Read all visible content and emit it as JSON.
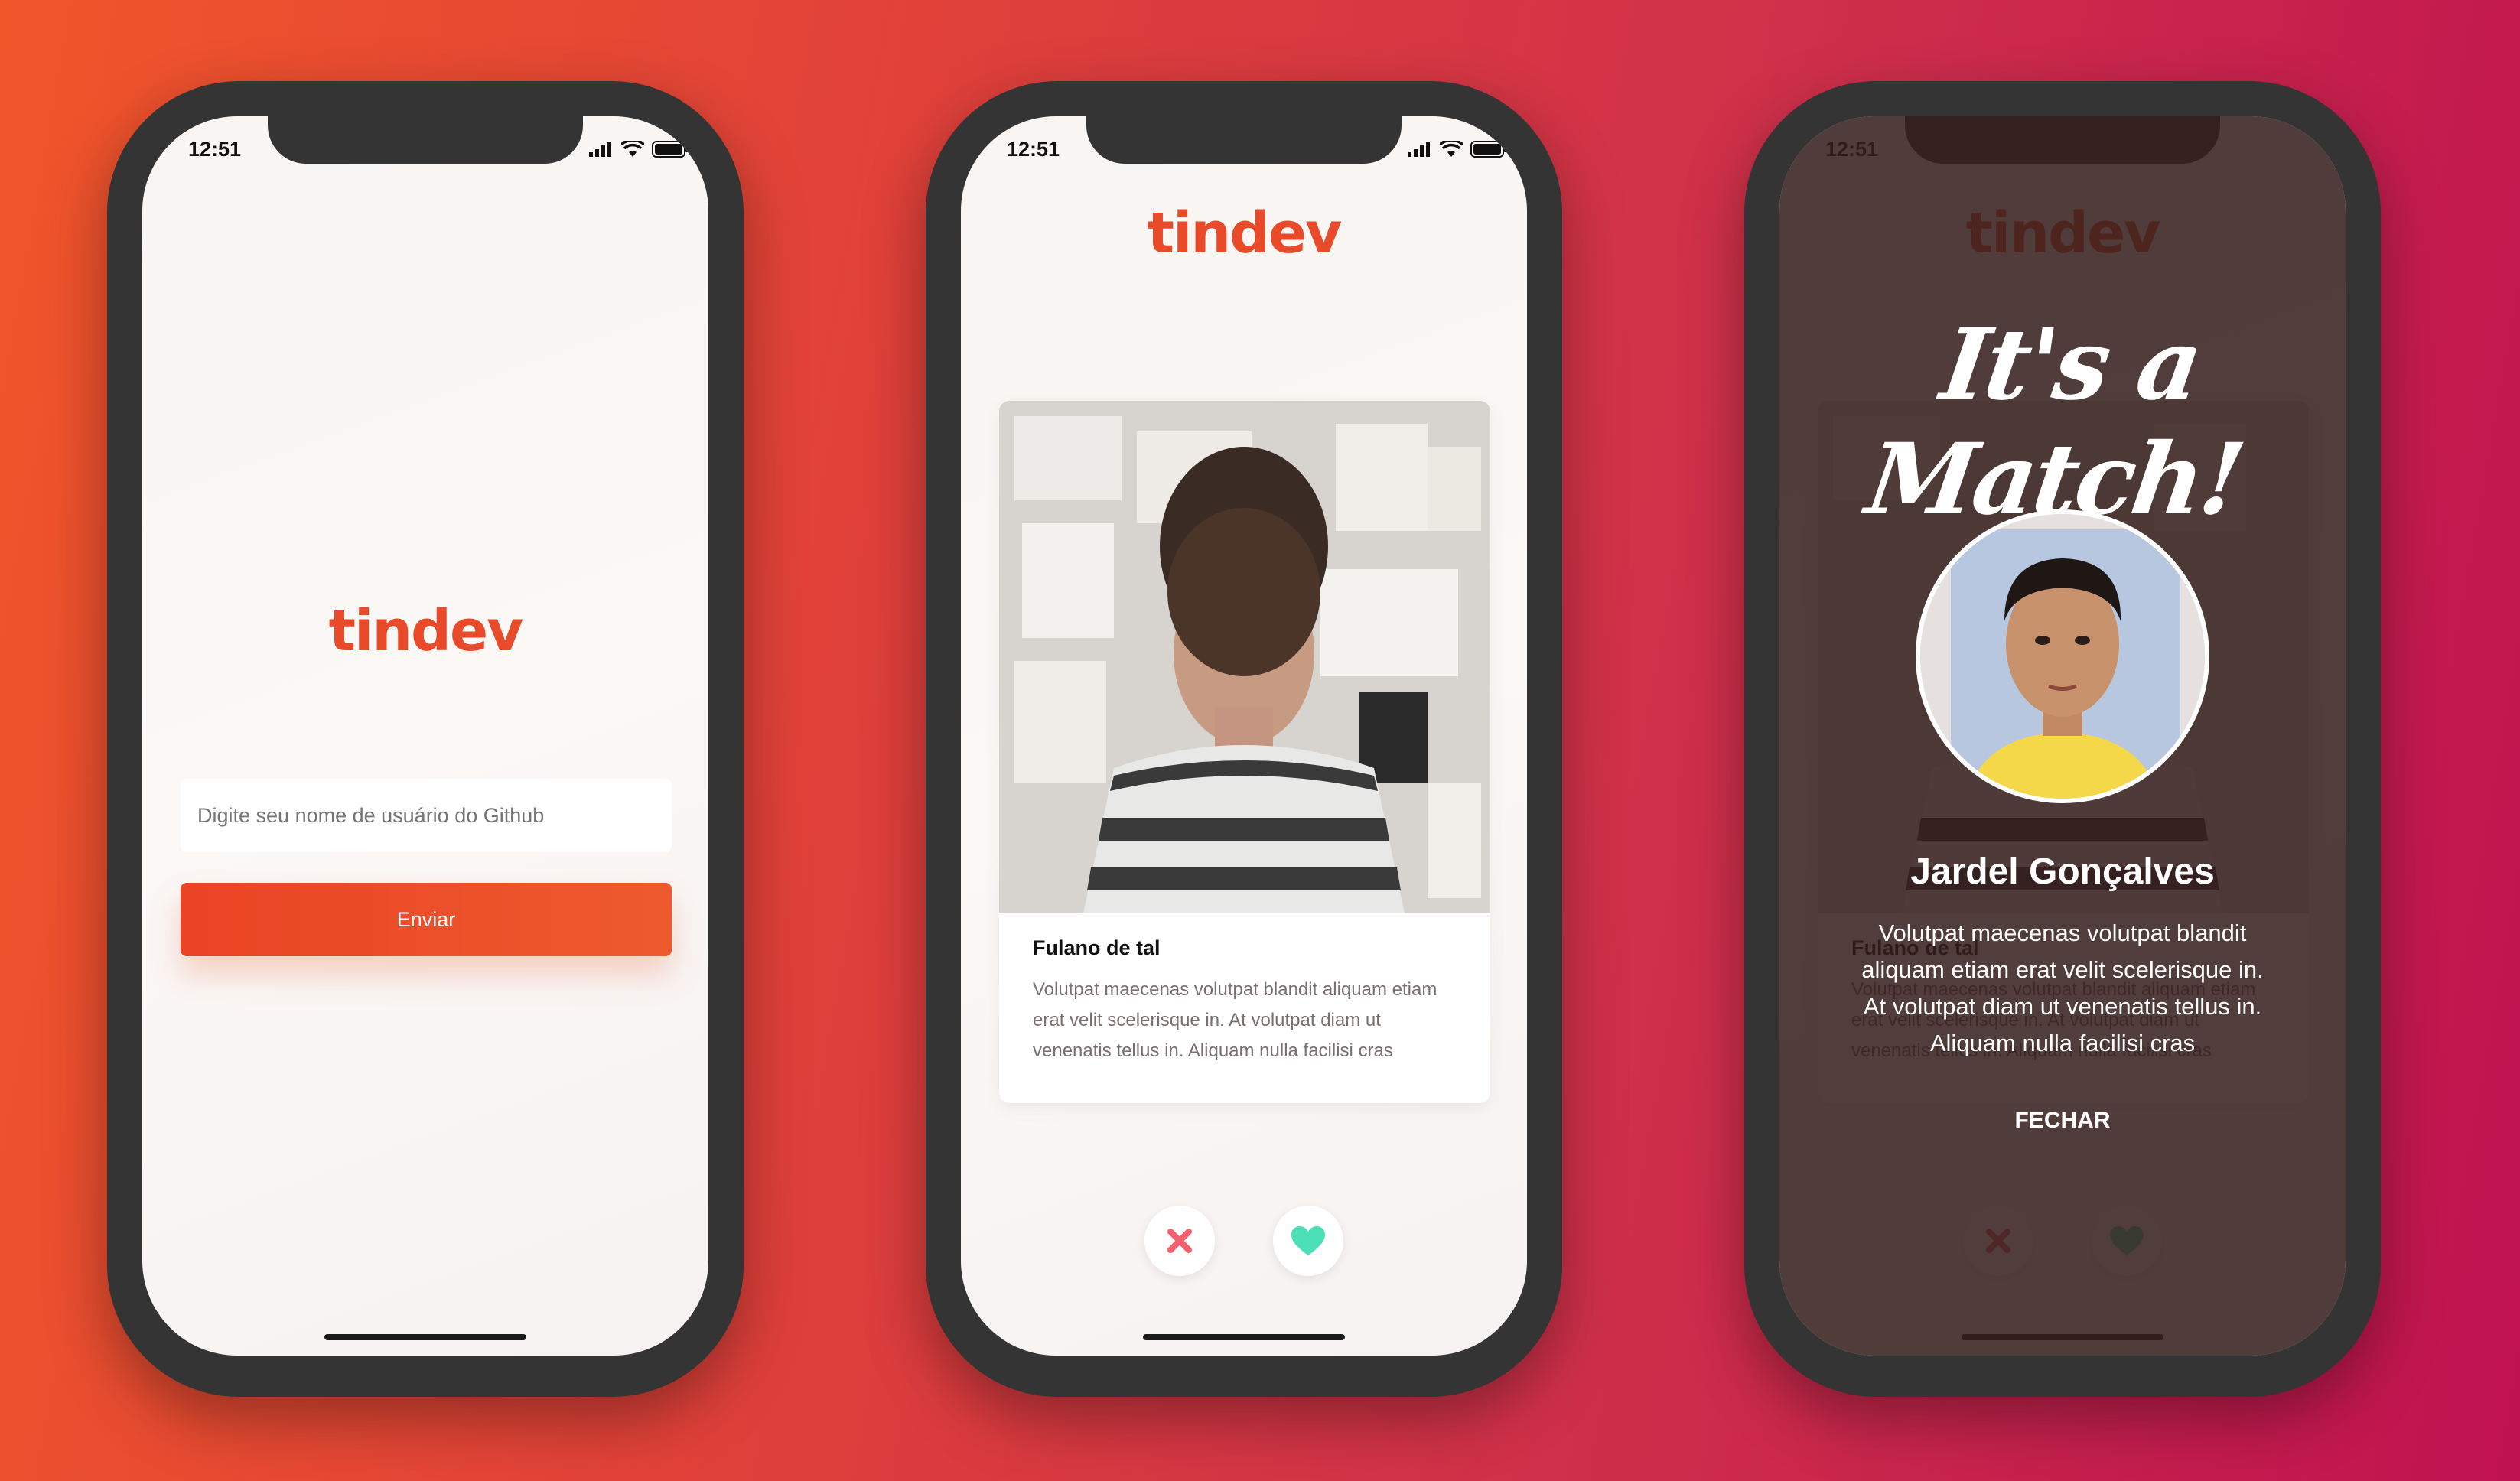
{
  "status_bar": {
    "time": "12:51"
  },
  "brand": {
    "logo_text": "tindev",
    "logo_color": "#e84a2a"
  },
  "login": {
    "input_placeholder": "Digite seu nome de usuário do Github",
    "submit_label": "Enviar"
  },
  "main": {
    "card": {
      "name": "Fulano de tal",
      "bio": "Volutpat maecenas volutpat blandit aliquam etiam erat velit scelerisque in. At volutpat diam ut venenatis tellus in. Aliquam nulla facilisi cras"
    },
    "dislike_icon": "x-icon",
    "like_icon": "heart-icon",
    "colors": {
      "dislike": "#f25f6d",
      "like": "#4de0b8"
    }
  },
  "match": {
    "title": "It's a Match!",
    "name": "Jardel Gonçalves",
    "bio": "Volutpat maecenas volutpat blandit aliquam etiam erat velit scelerisque in. At volutpat diam ut venenatis tellus in. Aliquam nulla facilisi cras",
    "close_label": "FECHAR"
  }
}
